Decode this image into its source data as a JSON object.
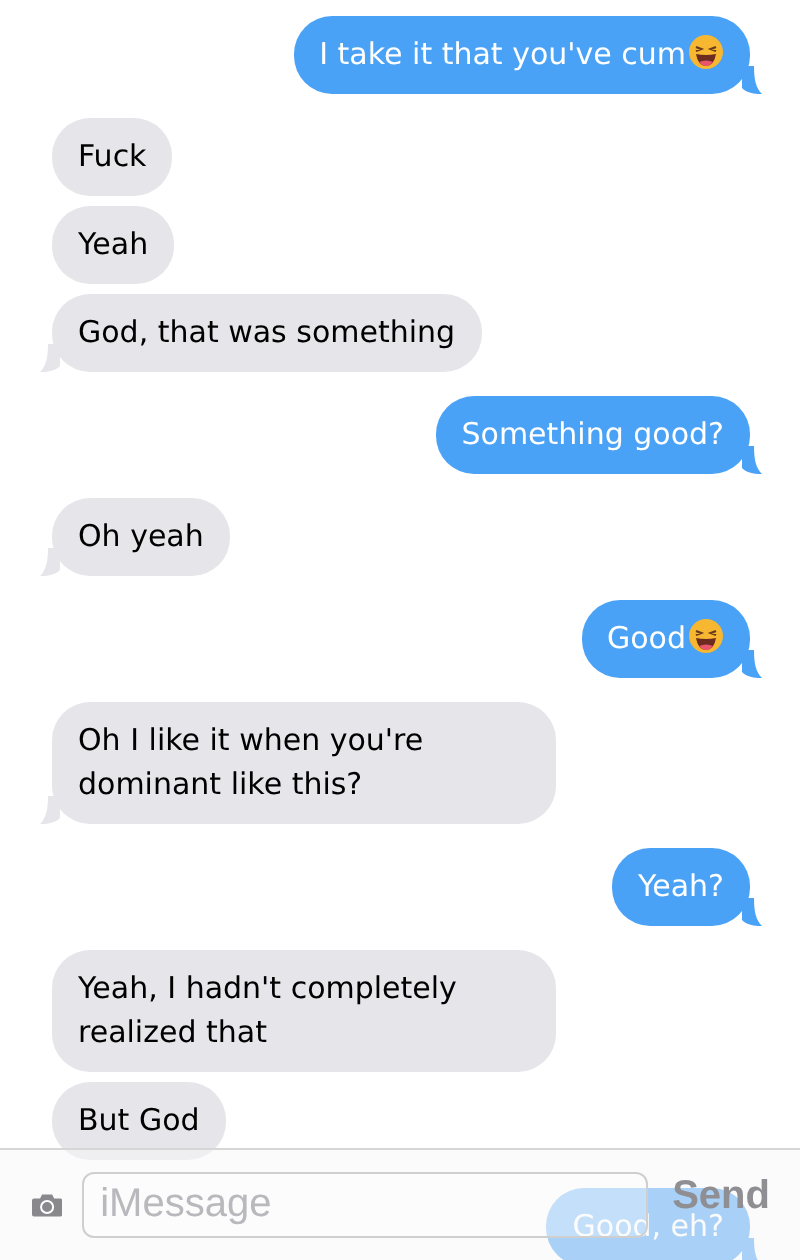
{
  "messages": [
    {
      "kind": "sent",
      "text": "I take it that you've cum",
      "emoji": true,
      "tail": true
    },
    {
      "kind": "received",
      "text": "Fuck",
      "emoji": false,
      "tail": false
    },
    {
      "kind": "received",
      "text": "Yeah",
      "emoji": false,
      "tail": false
    },
    {
      "kind": "received",
      "text": "God, that was something",
      "emoji": false,
      "tail": true
    },
    {
      "kind": "sent",
      "text": "Something good?",
      "emoji": false,
      "tail": true
    },
    {
      "kind": "received",
      "text": "Oh yeah",
      "emoji": false,
      "tail": true
    },
    {
      "kind": "sent",
      "text": "Good",
      "emoji": true,
      "tail": true
    },
    {
      "kind": "received",
      "text": "Oh I like it when you're dominant like this?",
      "emoji": false,
      "tail": true
    },
    {
      "kind": "sent",
      "text": "Yeah?",
      "emoji": false,
      "tail": true
    },
    {
      "kind": "received",
      "text": "Yeah, I hadn't completely realized that",
      "emoji": false,
      "tail": false
    },
    {
      "kind": "received",
      "text": "But God",
      "emoji": false,
      "tail": false
    },
    {
      "kind": "sent",
      "text": "Good, eh?",
      "emoji": false,
      "tail": true
    }
  ],
  "composer": {
    "placeholder": "iMessage",
    "send_label": "Send"
  }
}
